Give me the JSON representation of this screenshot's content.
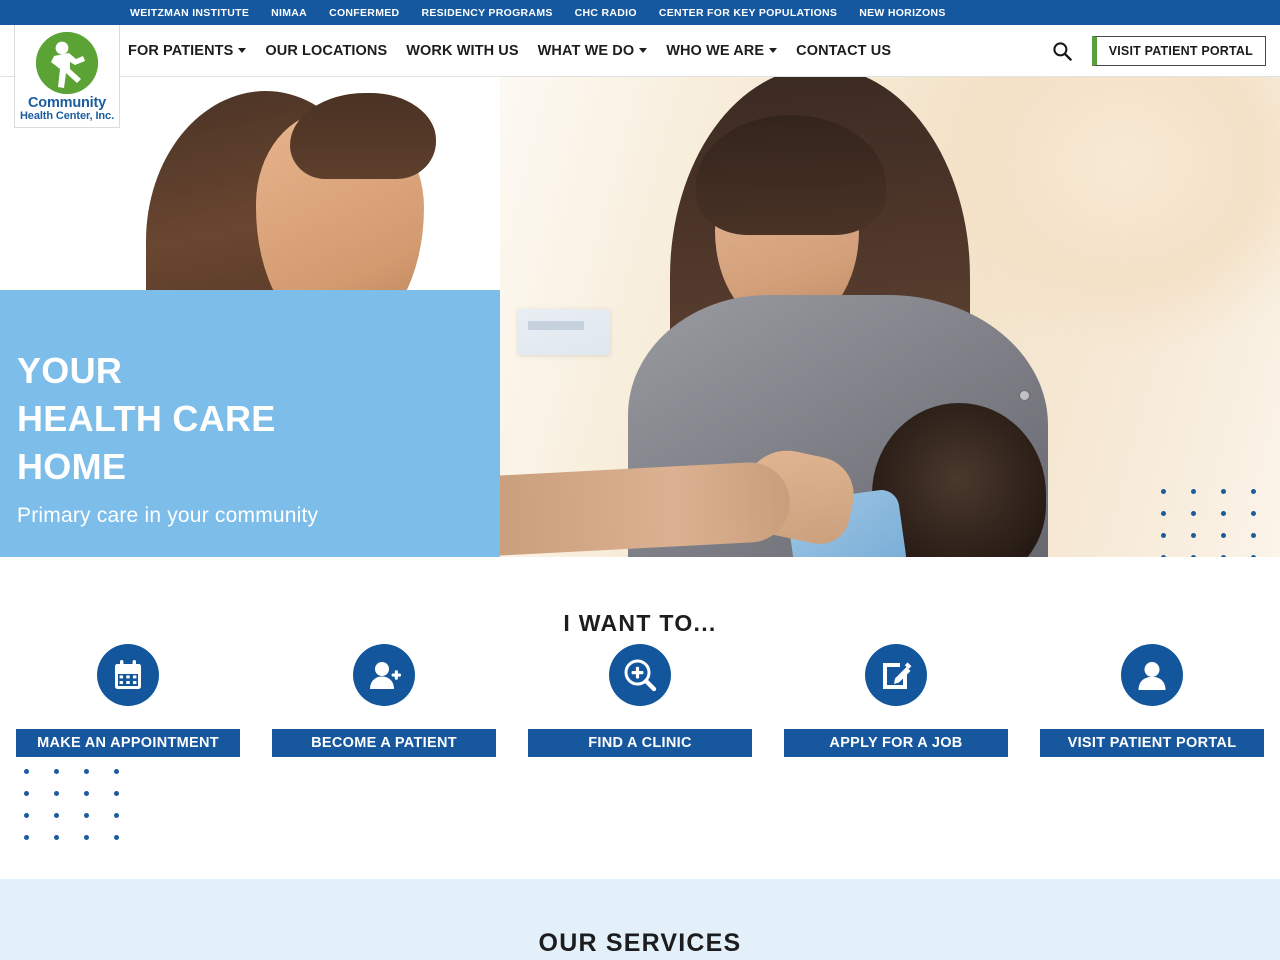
{
  "topbar": {
    "links": [
      "WEITZMAN INSTITUTE",
      "NIMAA",
      "CONFERMED",
      "RESIDENCY PROGRAMS",
      "CHC RADIO",
      "CENTER FOR KEY POPULATIONS",
      "NEW HORIZONS"
    ]
  },
  "logo": {
    "line1": "Community",
    "line2": "Health Center, Inc.",
    "mark": "running-figure-icon"
  },
  "nav": {
    "items": [
      {
        "label": "FOR PATIENTS",
        "has_dropdown": true
      },
      {
        "label": "OUR LOCATIONS",
        "has_dropdown": false
      },
      {
        "label": "WORK WITH US",
        "has_dropdown": false
      },
      {
        "label": "WHAT WE DO",
        "has_dropdown": true
      },
      {
        "label": "WHO WE ARE",
        "has_dropdown": true
      },
      {
        "label": "CONTACT US",
        "has_dropdown": false
      }
    ],
    "search_icon": "search-icon",
    "portal_button": "VISIT PATIENT PORTAL"
  },
  "hero": {
    "heading_line1": "YOUR",
    "heading_line2": "HEALTH CARE",
    "heading_line3": "HOME",
    "subheading": "Primary care in your community",
    "overlay_color": "#7cbde9"
  },
  "want_section": {
    "title": "I WANT TO...",
    "tiles": [
      {
        "label": "MAKE AN APPOINTMENT",
        "icon": "calendar-icon"
      },
      {
        "label": "BECOME A PATIENT",
        "icon": "person-add-icon"
      },
      {
        "label": "FIND A CLINIC",
        "icon": "search-plus-icon"
      },
      {
        "label": "APPLY FOR A JOB",
        "icon": "pencil-square-icon"
      },
      {
        "label": "VISIT PATIENT PORTAL",
        "icon": "user-avatar-icon"
      }
    ]
  },
  "services_section": {
    "title": "OUR SERVICES"
  },
  "colors": {
    "brand_blue": "#15589f",
    "brand_green": "#5aa334",
    "hero_blue": "#7cbde9",
    "tile_blue": "#17579e",
    "services_bg": "#e4f0f9"
  }
}
